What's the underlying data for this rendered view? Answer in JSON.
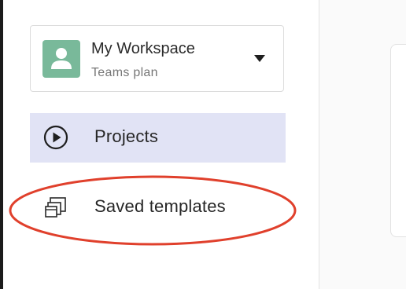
{
  "workspace": {
    "name": "My Workspace",
    "plan": "Teams plan",
    "avatar_color": "#79b99a"
  },
  "nav": {
    "items": [
      {
        "label": "Projects",
        "icon": "play-circle-icon",
        "active": true
      },
      {
        "label": "Saved templates",
        "icon": "templates-icon",
        "active": false
      }
    ]
  },
  "colors": {
    "active_background": "#e1e3f5",
    "annotation": "#e0402c"
  }
}
